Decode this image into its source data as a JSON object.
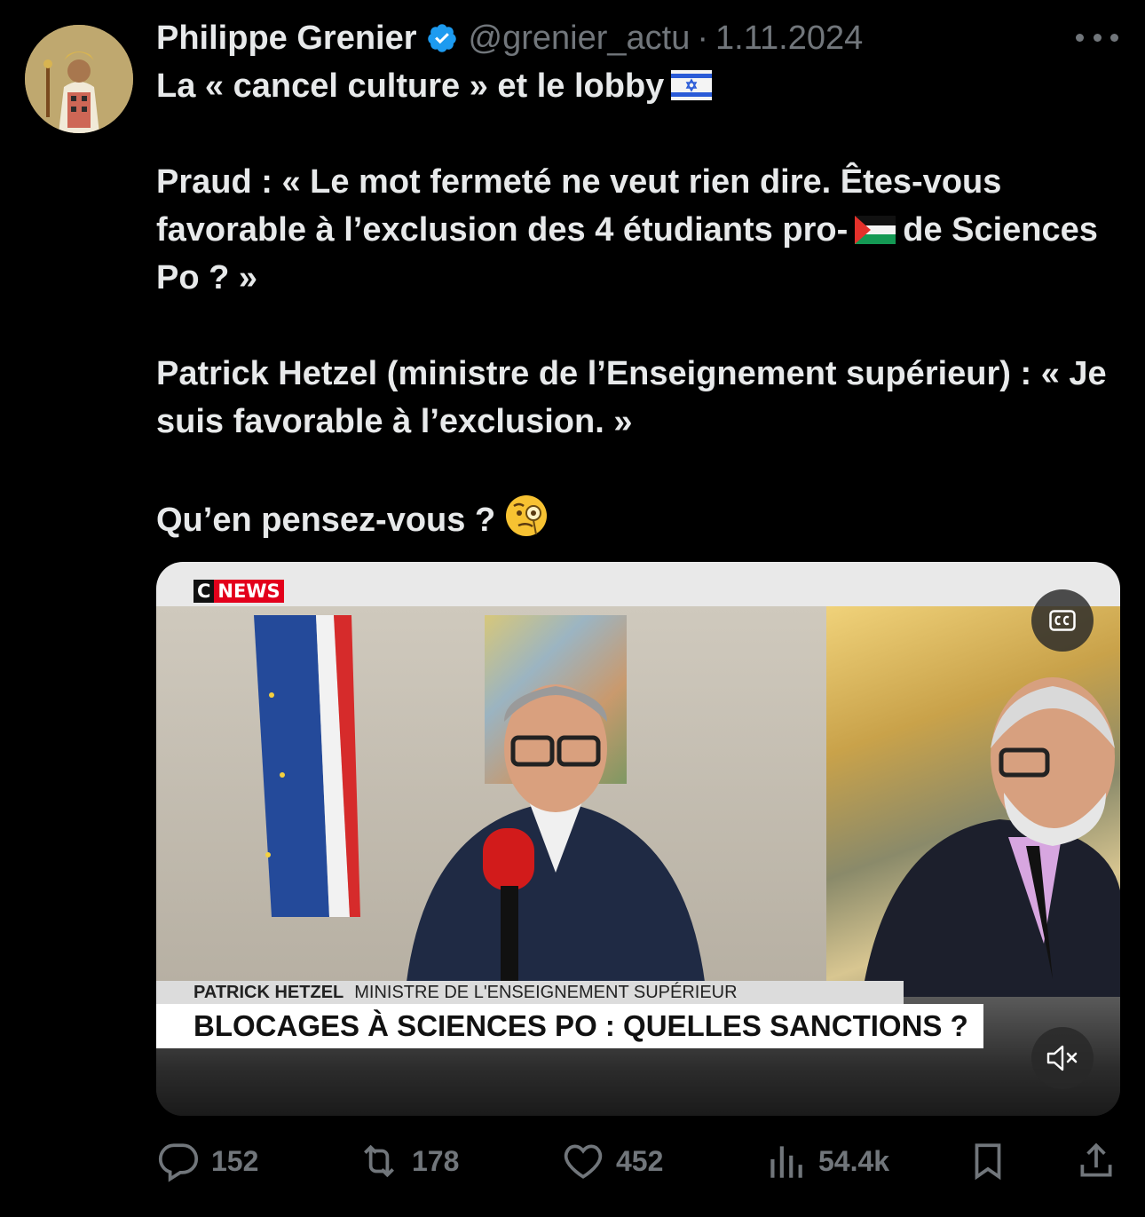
{
  "author": {
    "display_name": "Philippe Grenier",
    "handle": "@grenier_actu",
    "date": "1.11.2024",
    "verified": true
  },
  "tweet": {
    "line1": "La « cancel culture » et le lobby",
    "para2_a": "Praud : « Le mot fermeté ne veut rien dire. Êtes-vous favorable à l’exclusion des 4 étudiants pro-",
    "para2_b": "de Sciences Po ? »",
    "para3": "Patrick Hetzel (ministre de l’Enseignement supérieur) : « Je suis favorable à l’exclusion. »",
    "para4": "Qu’en pensez-vous ?"
  },
  "media": {
    "channel_c": "C",
    "channel_news": "NEWS",
    "guest_name": "PATRICK HETZEL",
    "guest_role": "MINISTRE DE L'ENSEIGNEMENT SUPÉRIEUR",
    "headline": "BLOCAGES À SCIENCES PO : QUELLES SANCTIONS ?",
    "cc_icon": "closed-captions-icon",
    "mute_icon": "muted-speaker-icon"
  },
  "actions": {
    "replies": "152",
    "reposts": "178",
    "likes": "452",
    "views": "54.4k"
  },
  "colors": {
    "background": "#000000",
    "text": "#e7e9ea",
    "muted": "#71767b",
    "verified": "#1d9bf0",
    "cnews_red": "#e3001b"
  }
}
